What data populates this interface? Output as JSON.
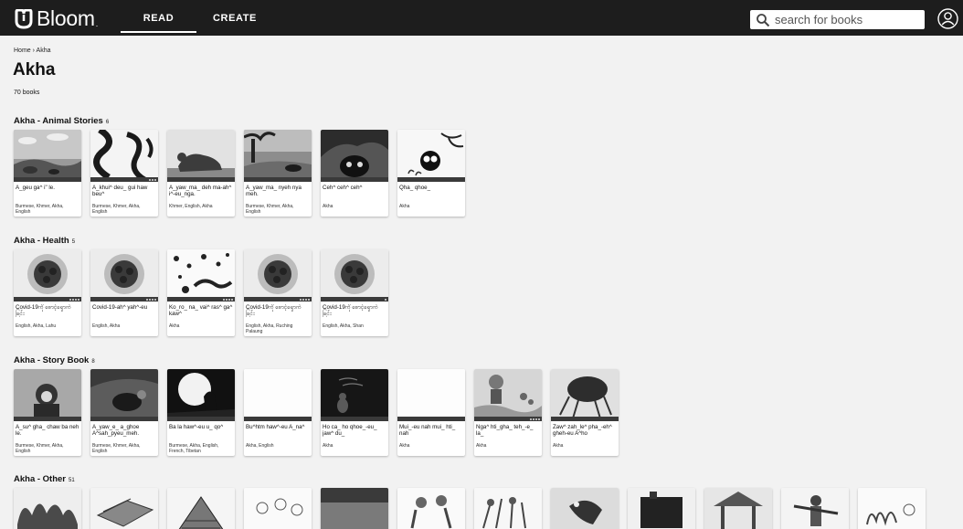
{
  "header": {
    "logo_text": "Bloom",
    "logo_dot": ".",
    "tabs": [
      {
        "label": "READ"
      },
      {
        "label": "CREATE"
      }
    ],
    "search": {
      "placeholder": "search for books"
    }
  },
  "breadcrumb": {
    "home": "Home",
    "separator": "›",
    "current": "Akha"
  },
  "page": {
    "title": "Akha",
    "count": "70 books"
  },
  "sections": [
    {
      "title": "Akha - Animal Stories",
      "count": "6",
      "books": [
        {
          "title": "A_geu ga^ i\" le.",
          "langs": "Burmese, Khmer, Akha, English"
        },
        {
          "title": "A_khui^ deu_ gui haw beu^",
          "langs": "Burmese, Khmer, Akha, English"
        },
        {
          "title": "A_yaw_ma_ deh ma-ah^ i^-eu_nga.",
          "langs": "Khmer, English, Akha"
        },
        {
          "title": "A_yaw_ma_ nyeh nya meh.",
          "langs": "Burmese, Khmer, Akha, English"
        },
        {
          "title": "Ceh^ ceh^ ceh^",
          "langs": "Akha"
        },
        {
          "title": "Qha_ qhoe_",
          "langs": "Akha"
        }
      ]
    },
    {
      "title": "Akha - Health",
      "count": "5",
      "books": [
        {
          "title": "Covid-19ကို စောင့်ရှောက်ခြင်း",
          "langs": "English, Akha, Lahu"
        },
        {
          "title": "Covid-19-ah^ yah^-eu",
          "langs": "English, Akha"
        },
        {
          "title": "Ko_ro_ na_ vai^ ras^ ga^ kaw^",
          "langs": "Akha"
        },
        {
          "title": "Covid-19ကို စောင့်ရှောက်ခြင်း",
          "langs": "English, Akha, Ruching Palaung"
        },
        {
          "title": "Covid-19ကို စောင့်ရှောက်ခြင်း",
          "langs": "English, Akha, Shan"
        }
      ]
    },
    {
      "title": "Akha - Story Book",
      "count": "8",
      "books": [
        {
          "title": "A_su^ gha_ chaw ba neh le.",
          "langs": "Burmese, Khmer, Akha, English"
        },
        {
          "title": "A_yaw_e_ a_ghoe A^sah_pyeu_meh.",
          "langs": "Burmese, Khmer, Akha, English"
        },
        {
          "title": "Ba la haw^-eu u_ qo^",
          "langs": "Burmese, Akha, English, French, Tibetan"
        },
        {
          "title": "Bu^htm haw^-eu A_na^",
          "langs": "Akha, English"
        },
        {
          "title": "Ho ca_ ho qhoe_-eu_ jaw^ du_",
          "langs": "Akha"
        },
        {
          "title": "Mui_-eu nah mui_ hti_ nah",
          "langs": "Akha"
        },
        {
          "title": "Nga^ hti_gha_ teh_-e_ la_",
          "langs": "Akha"
        },
        {
          "title": "Zaw^ zah_le^ pha_-eh^ gheh-eu A^ho",
          "langs": "Akha"
        }
      ]
    },
    {
      "title": "Akha - Other",
      "count": "51",
      "books": []
    }
  ]
}
